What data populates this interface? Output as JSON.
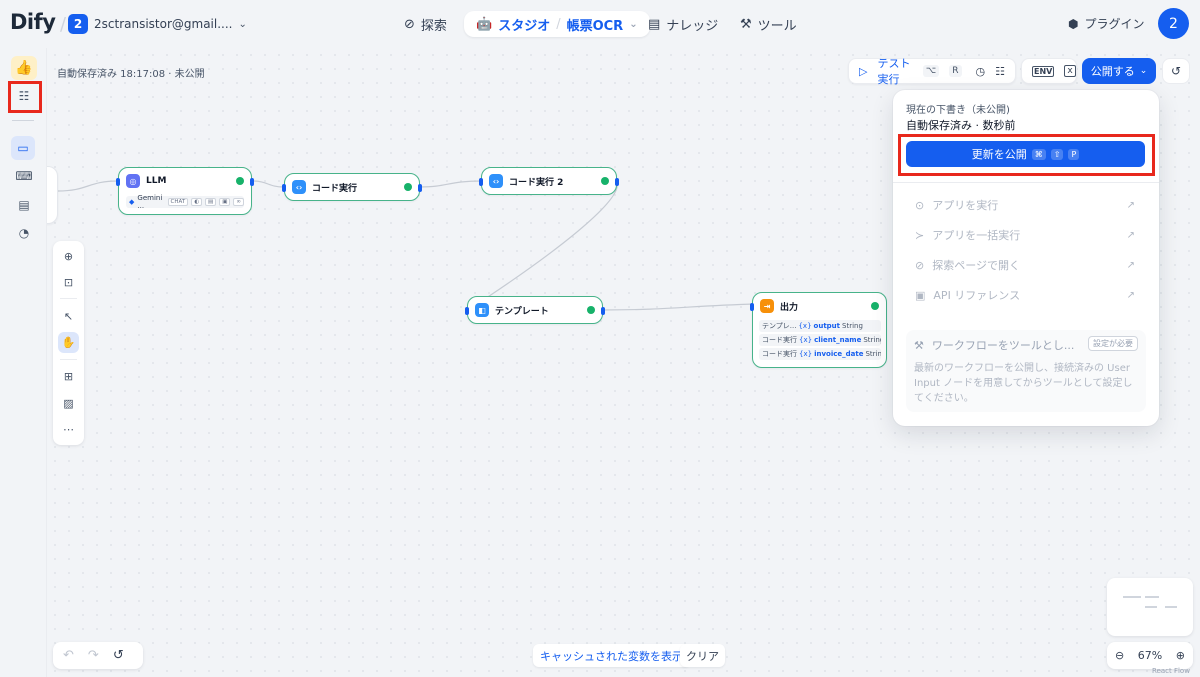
{
  "header": {
    "logo": "Dify",
    "workspace_badge": "2",
    "workspace_name": "2sctransistor@gmail....",
    "nav_explore": "探索",
    "nav_studio": "スタジオ",
    "app_name": "帳票OCR",
    "nav_knowledge": "ナレッジ",
    "nav_tools": "ツール",
    "plugins": "プラグイン",
    "avatar": "2"
  },
  "status": {
    "autosave": "自動保存済み 18:17:08 · 未公開"
  },
  "toolbar": {
    "test_run": "テスト実行",
    "test_run_keys": [
      "⌥",
      "R"
    ],
    "env": "ENV",
    "publish": "公開する"
  },
  "publish_popup": {
    "current_draft": "現在の下書き（未公開)",
    "autosaved": "自動保存済み · 数秒前",
    "update_publish": "更新を公開",
    "update_keys": [
      "⌘",
      "⇧",
      "P"
    ],
    "items": [
      {
        "label": "アプリを実行",
        "icon": "play-icon"
      },
      {
        "label": "アプリを一括実行",
        "icon": "batch-run-icon"
      },
      {
        "label": "探索ページで開く",
        "icon": "explore-icon"
      },
      {
        "label": "API リファレンス",
        "icon": "api-icon"
      }
    ],
    "workflow_tool_title": "ワークフローをツールとし...",
    "workflow_tool_badge": "設定が必要",
    "workflow_tool_desc": "最新のワークフローを公開し、接続済みの User Input ノードを用意してからツールとして設定してください。"
  },
  "nodes": {
    "llm": {
      "title": "LLM",
      "model": "Gemini ...",
      "chip": "CHAT"
    },
    "code1": {
      "title": "コード実行"
    },
    "code2": {
      "title": "コード実行 2"
    },
    "template": {
      "title": "テンプレート"
    },
    "output": {
      "title": "出力",
      "rows": [
        {
          "src": "テンプレ...",
          "var": "output",
          "type": "String"
        },
        {
          "src": "コード実行",
          "var": "client_name",
          "type": "String"
        },
        {
          "src": "コード実行",
          "var": "invoice_date",
          "type": "String"
        }
      ]
    }
  },
  "bottom": {
    "cached_vars": "キャッシュされた変数を表示",
    "clear": "クリア",
    "zoom": "67%",
    "react_flow": "React Flow"
  },
  "colors": {
    "accent": "#155eef",
    "node_border": "#47b38a",
    "success": "#17b26a",
    "highlight": "#e8281c"
  }
}
